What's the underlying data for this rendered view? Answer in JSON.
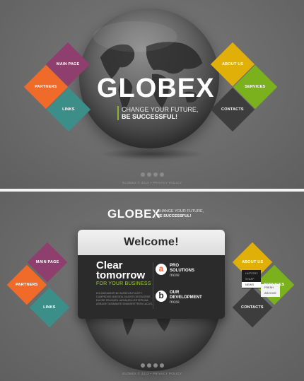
{
  "brand": {
    "logo": "GLOBEX",
    "slogan_line1": "CHANGE YOUR FUTURE,",
    "slogan_line2": "BE SUCCESSFUL!"
  },
  "nav": {
    "main_page": "MAIN PAGE",
    "partners": "PARTNERS",
    "links": "LINKS",
    "about_us": "ABOUT US",
    "services": "SERVICES",
    "contacts": "CONTACTS"
  },
  "footer": {
    "text": "GLOBEX © 2012 • PRIVACY POLICY"
  },
  "modal": {
    "title": "Welcome!",
    "headline_1": "Clear",
    "headline_2": "tomorrow",
    "subhead": "FOR YOUR BUSINESS",
    "body": "KOLNDEAMNITHM HASSELIN FULEFY. CUMPEDISS MIATODIL KAGNTS DISTACESIE DUCSE FEUGIATA LAGNUATA LESTEPIUNA ASRAGE TASIMANTE SIVANSISTTRON LACUS.",
    "feature_a_badge": "a",
    "feature_a_line1": "PRO",
    "feature_a_line2": "SOLUTIONS",
    "feature_a_more": "more",
    "feature_b_badge": "b",
    "feature_b_line1": "OUR",
    "feature_b_line2": "DEVELOPMENT",
    "feature_b_more": "more",
    "arrow_up": "▲",
    "arrow_down": "▼"
  },
  "submenu": {
    "items": [
      "HISTORY",
      "STAFF",
      "NEWS"
    ],
    "sub_items": [
      "FRESH",
      "ARCHIVE"
    ]
  },
  "colors": {
    "purple": "#8e3f6d",
    "orange": "#f06a2a",
    "teal": "#3b8f88",
    "yellow": "#e0b008",
    "green": "#7cb11e",
    "dark": "#3d3d3d",
    "accent": "#8ab62e"
  }
}
